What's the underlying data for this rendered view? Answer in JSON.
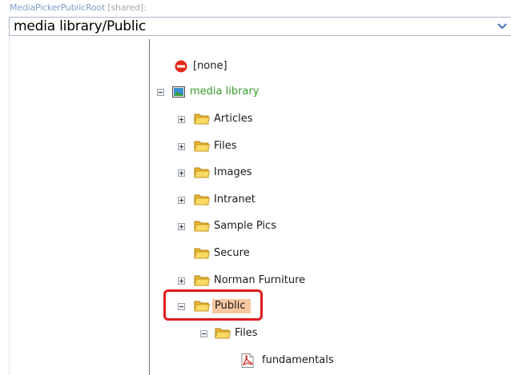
{
  "field": {
    "label": "MediaPickerPublicRoot",
    "shared_tag": "[shared]:",
    "value": "media library/Public"
  },
  "tree": {
    "none": "[none]",
    "root": "media library",
    "children": [
      "Articles",
      "Files",
      "Images",
      "Intranet",
      "Sample Pics",
      "Secure",
      "Norman Furniture",
      "Public"
    ],
    "public_children": {
      "folder": "Files",
      "file": "fundamentals"
    }
  },
  "colors": {
    "selection": "#f7c79f",
    "highlight_box": "#e21b1b",
    "root_label": "#3a9b2d",
    "field_label": "#7f9fc6"
  }
}
